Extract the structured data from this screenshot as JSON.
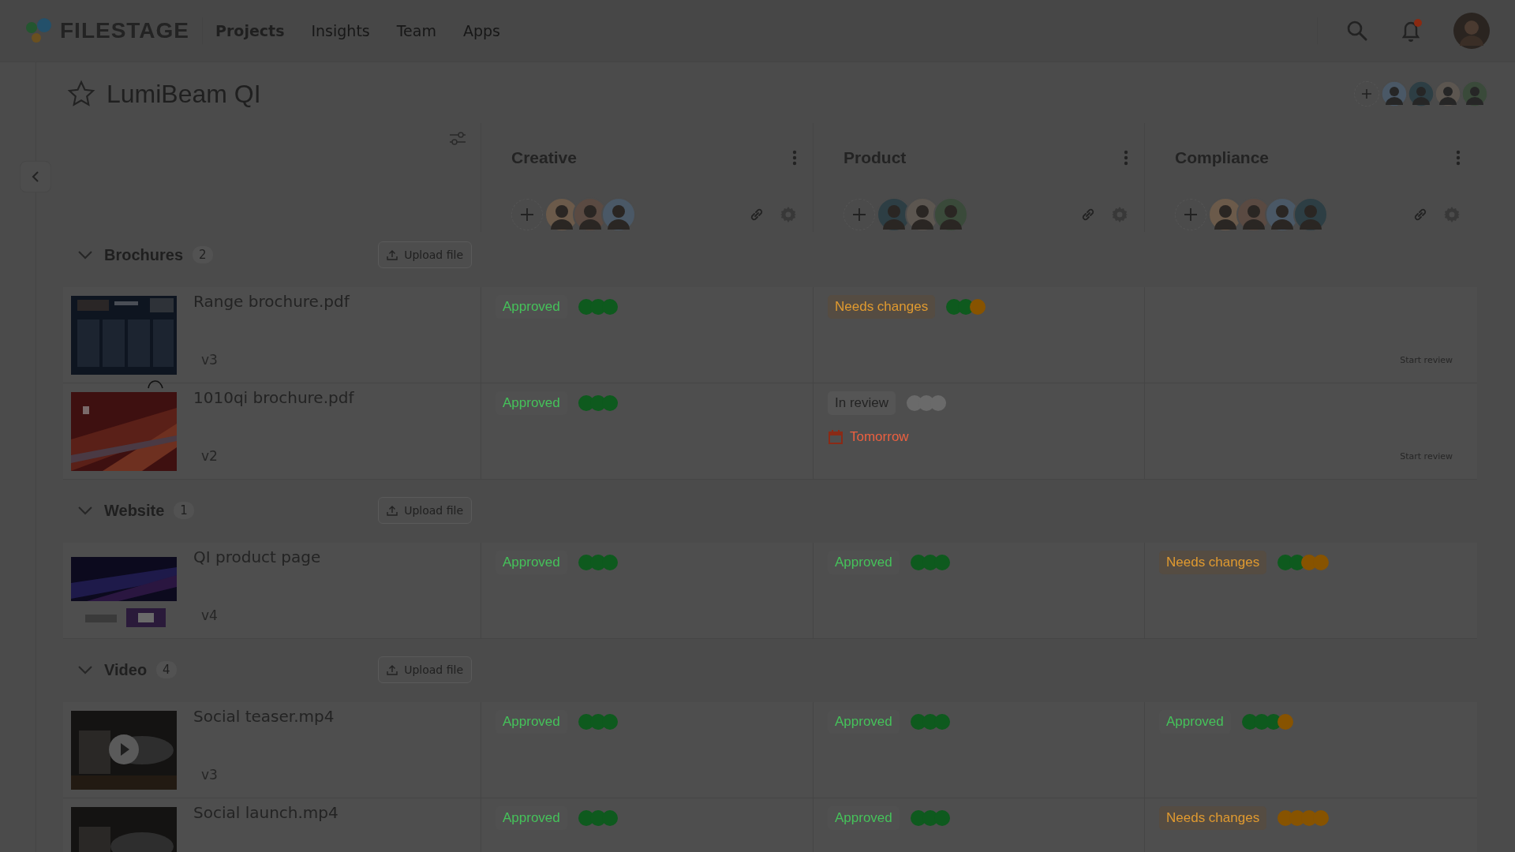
{
  "nav": {
    "logo": "FILESTAGE",
    "links": [
      {
        "label": "Projects",
        "selected": true
      },
      {
        "label": "Insights",
        "selected": false
      },
      {
        "label": "Team",
        "selected": false
      },
      {
        "label": "Apps",
        "selected": false
      }
    ],
    "notification": true
  },
  "project": {
    "title": "LumiBeam QI",
    "starred": false,
    "team": [
      {
        "kind": "avatar"
      },
      {
        "kind": "avatar"
      },
      {
        "kind": "avatar"
      },
      {
        "kind": "avatar"
      }
    ]
  },
  "stages": [
    {
      "name": "Creative",
      "reviewers": [
        {
          "kind": "avatar"
        },
        {
          "kind": "avatar"
        },
        {
          "kind": "avatar"
        }
      ]
    },
    {
      "name": "Product",
      "reviewers": [
        {
          "kind": "avatar"
        },
        {
          "kind": "avatar"
        },
        {
          "kind": "avatar"
        }
      ]
    },
    {
      "name": "Compliance",
      "reviewers": [
        {
          "kind": "avatar"
        },
        {
          "kind": "avatar"
        },
        {
          "kind": "avatar"
        },
        {
          "kind": "avatar"
        }
      ]
    }
  ],
  "sections": [
    {
      "name": "Brochures",
      "count": "2",
      "expanded": true,
      "upload": "Upload file",
      "files": [
        {
          "name": "Range brochure.pdf",
          "version": "v3",
          "kind": "brochure",
          "reviews": [
            {
              "kind": "approved",
              "label": "Approved",
              "dots": [
                {
                  "color": "#0e5a1e"
                },
                {
                  "color": "#0e5a1e"
                },
                {
                  "color": "#0e5a1e"
                }
              ]
            },
            {
              "kind": "changes",
              "label": "Needs changes",
              "dots": [
                {
                  "color": "#0e5a1e"
                },
                {
                  "color": "#0e5a1e"
                },
                {
                  "color": "#875300"
                }
              ]
            },
            {
              "kind": "empty",
              "action": "Start review"
            }
          ]
        },
        {
          "name": "1010qi brochure.pdf",
          "version": "v2",
          "kind": "light",
          "reviews": [
            {
              "kind": "approved",
              "label": "Approved",
              "dots": [
                {
                  "color": "#0e5a1e"
                },
                {
                  "color": "#0e5a1e"
                },
                {
                  "color": "#0e5a1e"
                }
              ]
            },
            {
              "kind": "review",
              "label": "In review",
              "due": "Tomorrow",
              "dots": [
                {
                  "color": "#6a6a6a"
                },
                {
                  "color": "#6a6a6a"
                },
                {
                  "color": "#6a6a6a"
                }
              ]
            },
            {
              "kind": "empty",
              "action": "Start review"
            }
          ]
        }
      ]
    },
    {
      "name": "Website",
      "count": "1",
      "expanded": true,
      "upload": "Upload file",
      "files": [
        {
          "name": "QI product page",
          "version": "v4",
          "kind": "web",
          "reviews": [
            {
              "kind": "approved",
              "label": "Approved",
              "dots": [
                {
                  "color": "#0e5a1e"
                },
                {
                  "color": "#0e5a1e"
                },
                {
                  "color": "#0e5a1e"
                }
              ]
            },
            {
              "kind": "approved",
              "label": "Approved",
              "dots": [
                {
                  "color": "#0e5a1e"
                },
                {
                  "color": "#0e5a1e"
                },
                {
                  "color": "#0e5a1e"
                }
              ]
            },
            {
              "kind": "changes",
              "label": "Needs changes",
              "dots": [
                {
                  "color": "#0e5a1e"
                },
                {
                  "color": "#0e5a1e"
                },
                {
                  "color": "#875300"
                },
                {
                  "color": "#875300"
                }
              ]
            }
          ]
        }
      ]
    },
    {
      "name": "Video",
      "count": "4",
      "expanded": true,
      "upload": "Upload file",
      "files": [
        {
          "name": "Social teaser.mp4",
          "version": "v3",
          "kind": "video",
          "reviews": [
            {
              "kind": "approved",
              "label": "Approved",
              "dots": [
                {
                  "color": "#0e5a1e"
                },
                {
                  "color": "#0e5a1e"
                },
                {
                  "color": "#0e5a1e"
                }
              ]
            },
            {
              "kind": "approved",
              "label": "Approved",
              "dots": [
                {
                  "color": "#0e5a1e"
                },
                {
                  "color": "#0e5a1e"
                },
                {
                  "color": "#0e5a1e"
                }
              ]
            },
            {
              "kind": "approved",
              "label": "Approved",
              "dots": [
                {
                  "color": "#0e5a1e"
                },
                {
                  "color": "#0e5a1e"
                },
                {
                  "color": "#0e5a1e"
                },
                {
                  "color": "#875300"
                }
              ]
            }
          ]
        },
        {
          "name": "Social launch.mp4",
          "kind": "clip",
          "reviews": [
            {
              "kind": "approved",
              "label": "Approved",
              "dots": [
                {
                  "color": "#0e5a1e"
                },
                {
                  "color": "#0e5a1e"
                },
                {
                  "color": "#0e5a1e"
                }
              ]
            },
            {
              "kind": "approved",
              "label": "Approved",
              "dots": [
                {
                  "color": "#0e5a1e"
                },
                {
                  "color": "#0e5a1e"
                },
                {
                  "color": "#0e5a1e"
                }
              ]
            },
            {
              "kind": "changes",
              "label": "Needs changes",
              "dots": [
                {
                  "color": "#875300"
                },
                {
                  "color": "#875300"
                },
                {
                  "color": "#875300"
                },
                {
                  "color": "#875300"
                }
              ]
            }
          ]
        }
      ]
    }
  ]
}
